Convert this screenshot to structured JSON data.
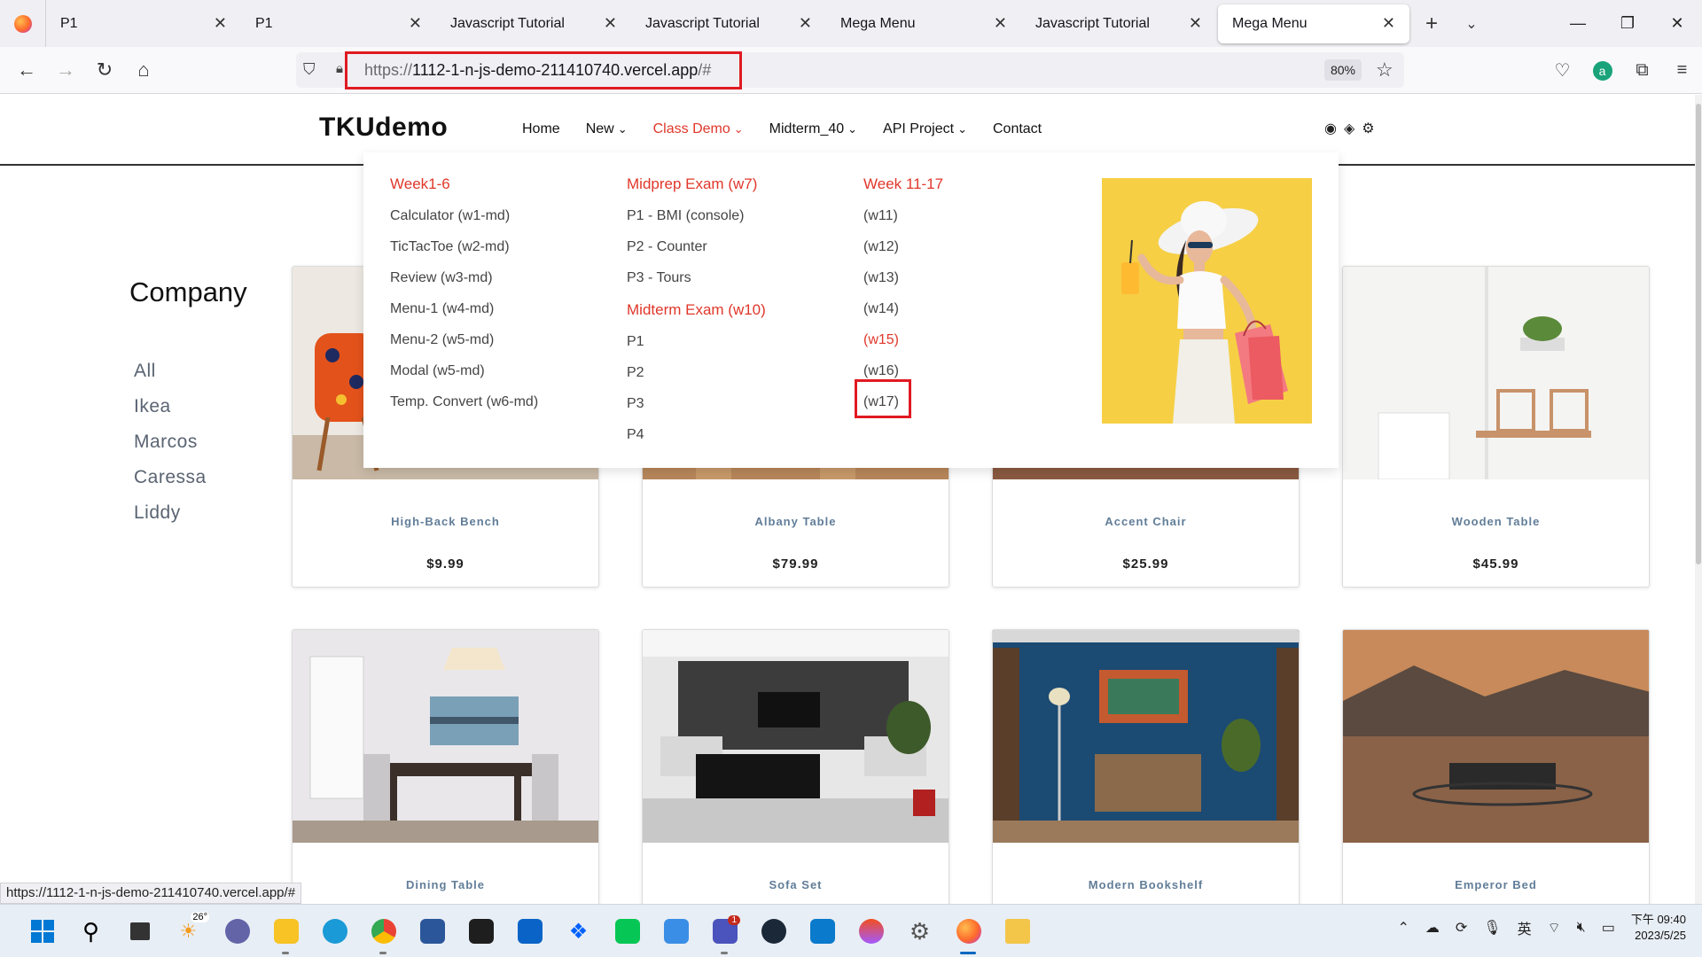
{
  "browser": {
    "tabs": [
      {
        "title": "P1",
        "active": false
      },
      {
        "title": "P1",
        "active": false
      },
      {
        "title": "Javascript Tutorial",
        "active": false
      },
      {
        "title": "Javascript Tutorial",
        "active": false
      },
      {
        "title": "Mega Menu",
        "active": false
      },
      {
        "title": "Javascript Tutorial",
        "active": false
      },
      {
        "title": "Mega Menu",
        "active": true
      }
    ],
    "url_prefix": "https://",
    "url_main": "1112-1-n-js-demo-211410740.vercel.app",
    "url_suffix": "/#",
    "zoom": "80%",
    "status_url": "https://1112-1-n-js-demo-211410740.vercel.app/#",
    "account_initial": "a"
  },
  "site": {
    "brand": "TKUdemo",
    "menu": [
      {
        "label": "Home",
        "has_dropdown": false,
        "active": false
      },
      {
        "label": "New",
        "has_dropdown": true,
        "active": false
      },
      {
        "label": "Class Demo",
        "has_dropdown": true,
        "active": true
      },
      {
        "label": "Midterm_40",
        "has_dropdown": true,
        "active": false
      },
      {
        "label": "API Project",
        "has_dropdown": true,
        "active": false
      },
      {
        "label": "Contact",
        "has_dropdown": false,
        "active": false
      }
    ],
    "social_icons": [
      "github-icon",
      "gitkraken-icon",
      "gear-icon"
    ]
  },
  "mega_menu": {
    "col1": {
      "heading": "Week1-6",
      "items": [
        "Calculator (w1-md)",
        "TicTacToe (w2-md)",
        "Review (w3-md)",
        "Menu-1 (w4-md)",
        "Menu-2 (w5-md)",
        "Modal (w5-md)",
        "Temp. Convert (w6-md)"
      ]
    },
    "col2": {
      "heading": "Midprep Exam (w7)",
      "items": [
        "P1 - BMI (console)",
        "P2 - Counter",
        "P3 - Tours"
      ],
      "heading2": "Midterm Exam (w10)",
      "items2": [
        "P1",
        "P2",
        "P3",
        "P4"
      ]
    },
    "col3": {
      "heading": "Week 11-17",
      "items": [
        "(w11)",
        "(w12)",
        "(w13)",
        "(w14)",
        "(w15)",
        "(w16)",
        "(w17)"
      ],
      "highlighted": "(w15)"
    }
  },
  "sidebar": {
    "title": "Company",
    "filters": [
      "All",
      "Ikea",
      "Marcos",
      "Caressa",
      "Liddy"
    ]
  },
  "products": [
    {
      "name": "High-Back Bench",
      "price": "$9.99"
    },
    {
      "name": "Albany Table",
      "price": "$79.99"
    },
    {
      "name": "Accent Chair",
      "price": "$25.99"
    },
    {
      "name": "Wooden Table",
      "price": "$45.99"
    },
    {
      "name": "Dining Table",
      "price": ""
    },
    {
      "name": "Sofa Set",
      "price": ""
    },
    {
      "name": "Modern Bookshelf",
      "price": ""
    },
    {
      "name": "Emperor Bed",
      "price": ""
    }
  ],
  "taskbar": {
    "weather_temp": "26°",
    "notif_badge": "1",
    "ime": "英",
    "time": "下午 09:40",
    "date": "2023/5/25"
  }
}
